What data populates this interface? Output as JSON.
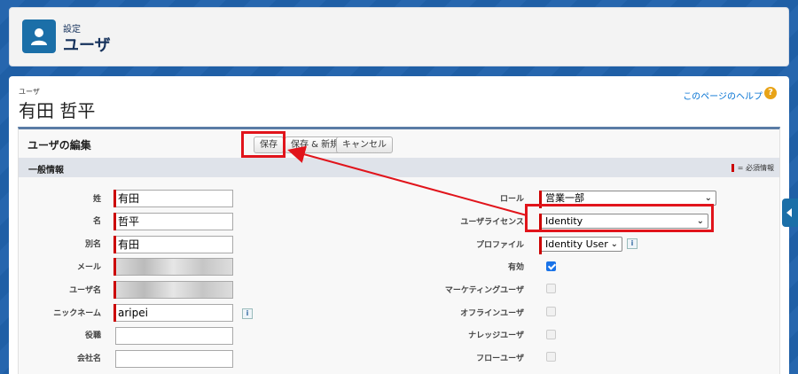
{
  "header": {
    "subtitle": "設定",
    "title": "ユーザ"
  },
  "user": {
    "kicker": "ユーザ",
    "name": "有田 哲平",
    "help_link": "このページのヘルプ",
    "help_icon": "?"
  },
  "edit": {
    "title": "ユーザの編集",
    "save_label": "保存",
    "save_new_label": "保存 & 新規",
    "cancel_label": "キャンセル"
  },
  "section": {
    "title": "一般情報",
    "legend": "= 必須情報"
  },
  "left_fields": [
    {
      "label": "姓",
      "value": "有田"
    },
    {
      "label": "名",
      "value": "哲平"
    },
    {
      "label": "別名",
      "value": "有田"
    },
    {
      "label": "メール",
      "value": ""
    },
    {
      "label": "ユーザ名",
      "value": ""
    },
    {
      "label": "ニックネーム",
      "value": "aripei"
    },
    {
      "label": "役職",
      "value": ""
    },
    {
      "label": "会社名",
      "value": ""
    }
  ],
  "right_fields": {
    "role_label": "ロール",
    "role_value": "営業一部",
    "license_label": "ユーザライセンス",
    "license_value": "Identity",
    "profile_label": "プロファイル",
    "profile_value": "Identity User",
    "active_label": "有効",
    "marketing_label": "マーケティングユーザ",
    "offline_label": "オフラインユーザ",
    "knowledge_label": "ナレッジユーザ",
    "flow_label": "フローユーザ"
  },
  "icons": {
    "info": "i",
    "user": "user-icon",
    "arrow": "red-annotation-arrow"
  },
  "colors": {
    "accent": "#1b6fa8",
    "required": "#cc0000",
    "highlight": "#e1141b"
  }
}
